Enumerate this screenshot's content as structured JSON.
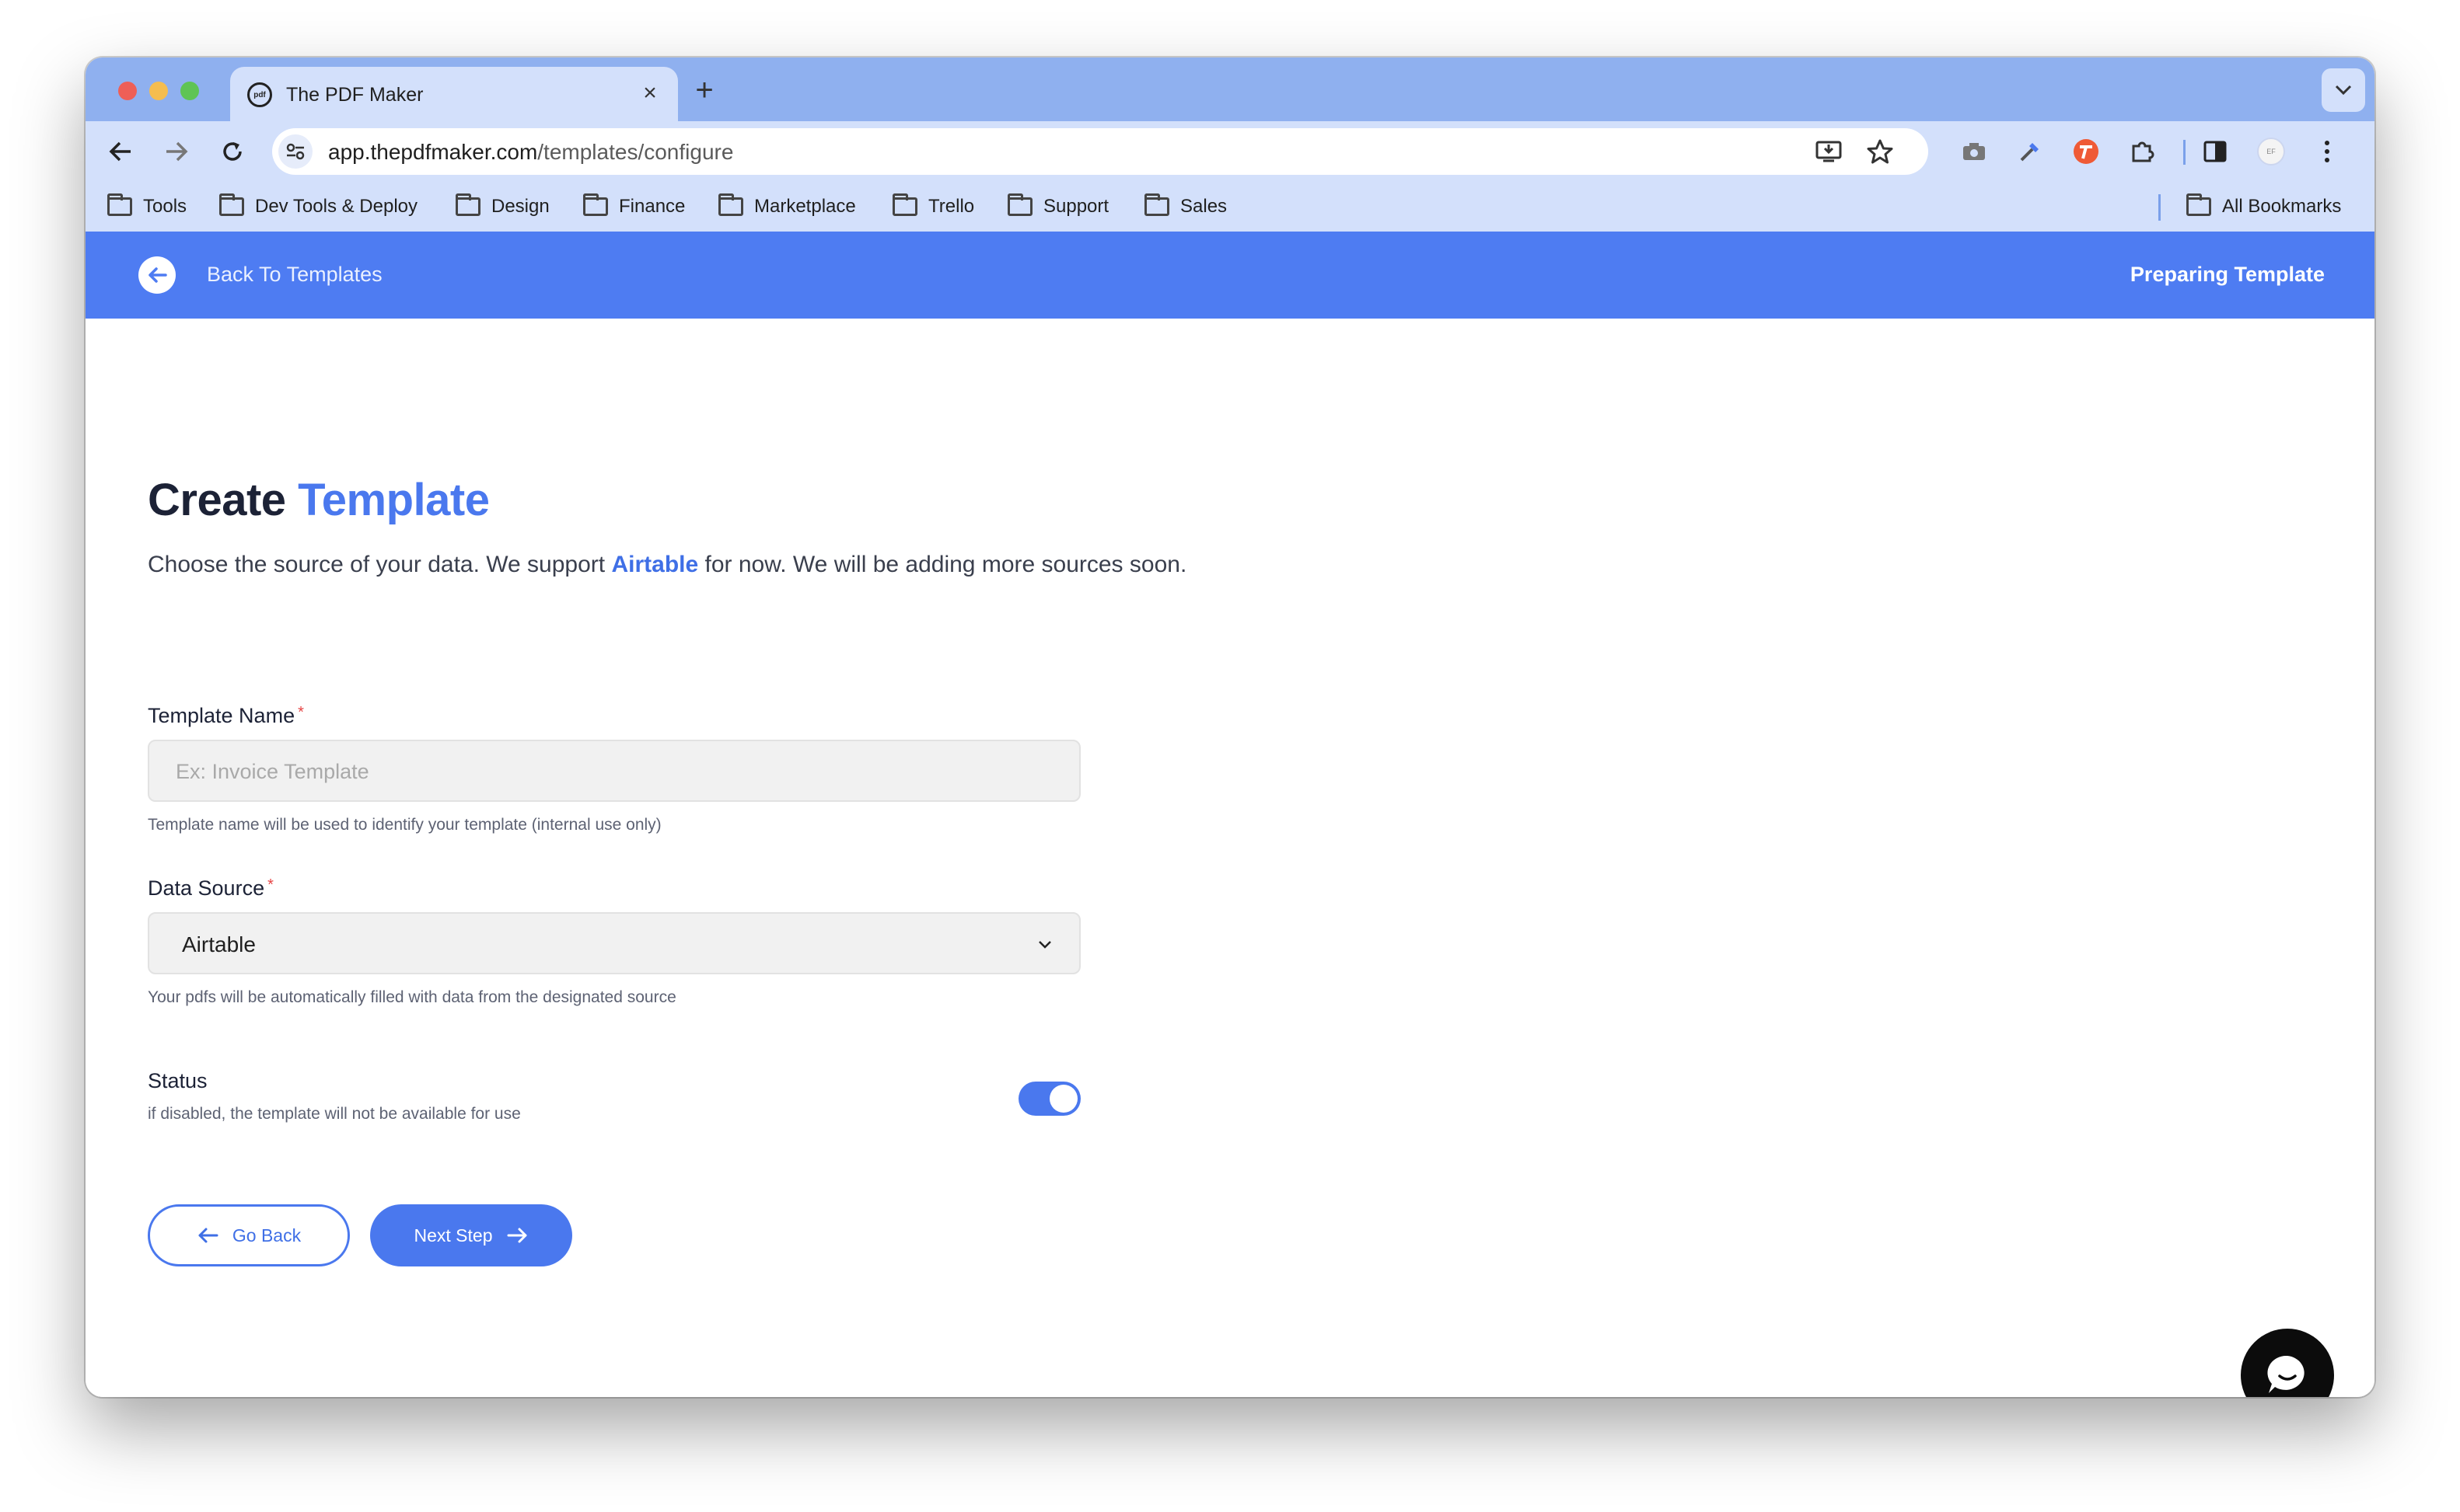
{
  "browser": {
    "tab": {
      "favicon_text": "pdf",
      "title": "The PDF Maker",
      "close": "×"
    },
    "new_tab": "+",
    "url": {
      "host": "app.thepdfmaker.com",
      "path": "/templates/configure"
    },
    "bookmarks": [
      "Tools",
      "Dev Tools & Deploy",
      "Design",
      "Finance",
      "Marketplace",
      "Trello",
      "Support",
      "Sales"
    ],
    "all_bookmarks": "All Bookmarks",
    "profile_initials": "EF"
  },
  "appbar": {
    "back_label": "Back To Templates",
    "status_label": "Preparing Template",
    "color": "#4e7cf2"
  },
  "page": {
    "title_main": "Create",
    "title_accent": "Template",
    "subtitle_before": "Choose the source of your data. We support",
    "subtitle_link": "Airtable",
    "subtitle_after": "for now. We will be adding more sources soon."
  },
  "form": {
    "template_name": {
      "label": "Template Name",
      "required": "*",
      "placeholder": "Ex: Invoice Template",
      "value": "",
      "help": "Template name will be used to identify your template (internal use only)"
    },
    "data_source": {
      "label": "Data Source",
      "required": "*",
      "value": "Airtable",
      "help": "Your pdfs will be automatically filled with data from the designated source"
    },
    "status": {
      "label": "Status",
      "help": "if disabled, the template will not be available for use",
      "enabled": true
    },
    "go_back": "Go Back",
    "next_step": "Next Step"
  },
  "colors": {
    "accent": "#4a78ee",
    "tabstrip": "#8fb0ef",
    "toolbar": "#d3e0fb"
  }
}
